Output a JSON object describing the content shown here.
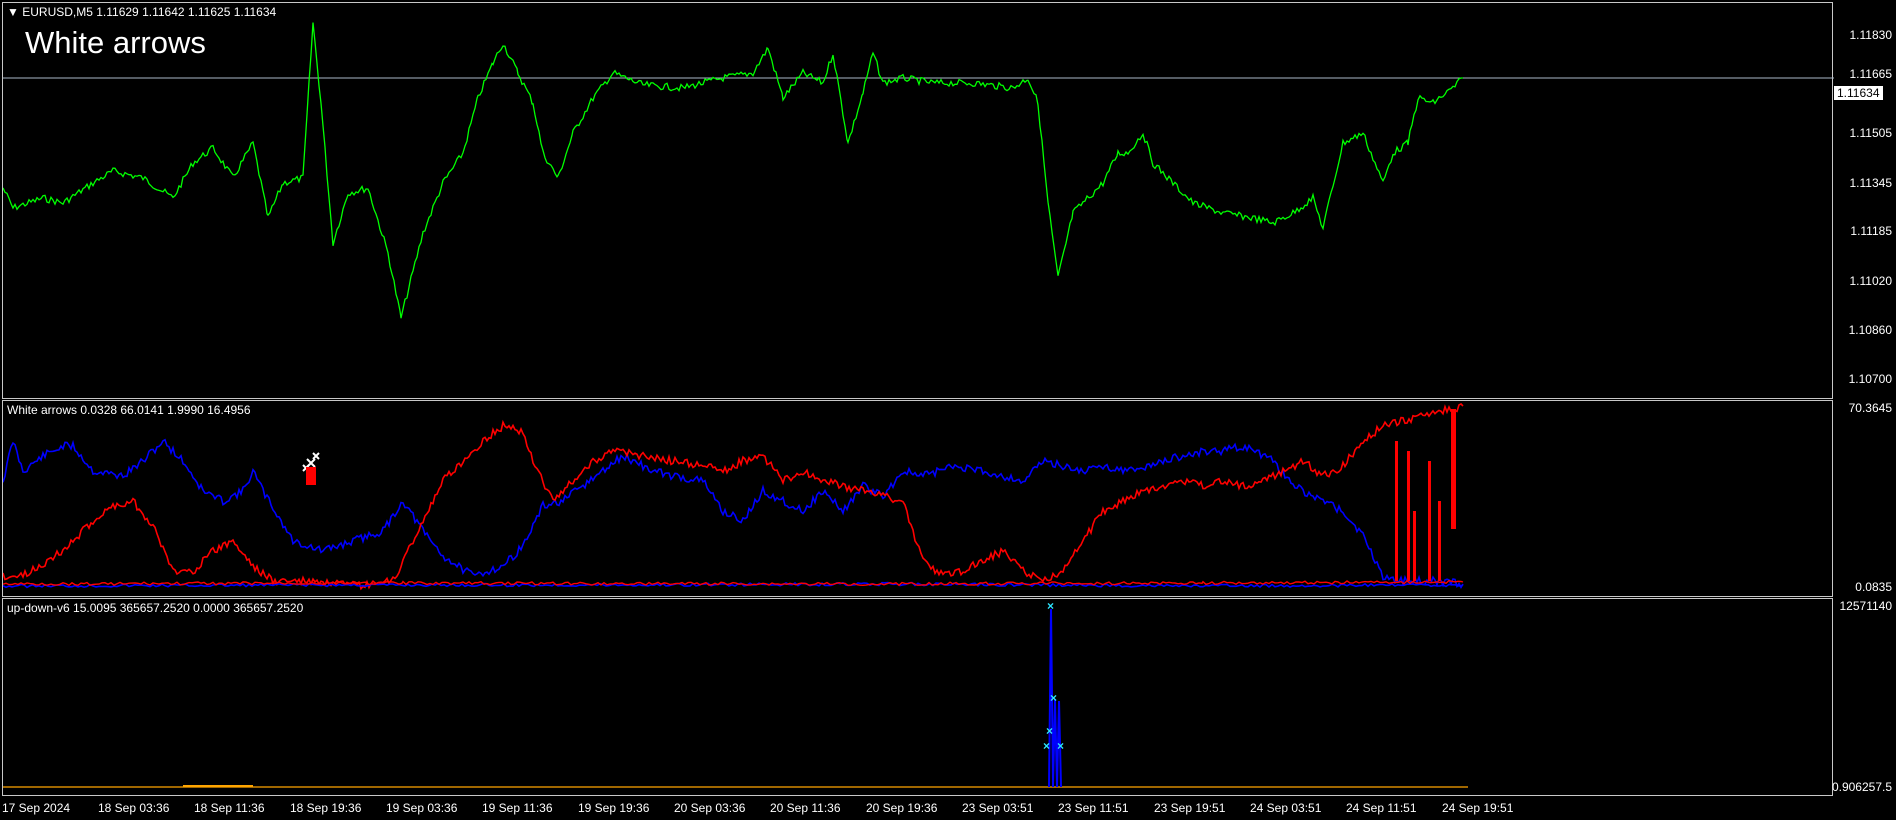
{
  "main": {
    "symbol_label": "EURUSD,M5  1.11629 1.11642 1.11625 1.11634",
    "overlay_title": "White arrows",
    "current_price": "1.11634",
    "price_ticks": [
      "1.11830",
      "1.11665",
      "1.11505",
      "1.11345",
      "1.11185",
      "1.11020",
      "1.10860",
      "1.10700"
    ],
    "line_color": "#00ff00"
  },
  "indicator1": {
    "label": "White arrows 0.0328 66.0141 1.9990 16.4956",
    "scale_top": "70.3645",
    "scale_bottom": "0.0835",
    "colors": {
      "blue": "#0000ff",
      "red": "#ff0000",
      "arrow": "#ffffff"
    }
  },
  "indicator2": {
    "label": "up-down-v6 15.0095 365657.2520 0.0000 365657.2520",
    "scale_top": "12571140",
    "scale_bottom": "0.906257.5",
    "colors": {
      "line": "#0000ff",
      "marker": "#2ee6ff",
      "baseline": "#ffa500"
    }
  },
  "time_axis": [
    "17 Sep 2024",
    "18 Sep 03:36",
    "18 Sep 11:36",
    "18 Sep 19:36",
    "19 Sep 03:36",
    "19 Sep 11:36",
    "19 Sep 19:36",
    "20 Sep 03:36",
    "20 Sep 11:36",
    "20 Sep 19:36",
    "23 Sep 03:51",
    "23 Sep 11:51",
    "23 Sep 19:51",
    "24 Sep 03:51",
    "24 Sep 11:51",
    "24 Sep 19:51"
  ]
}
